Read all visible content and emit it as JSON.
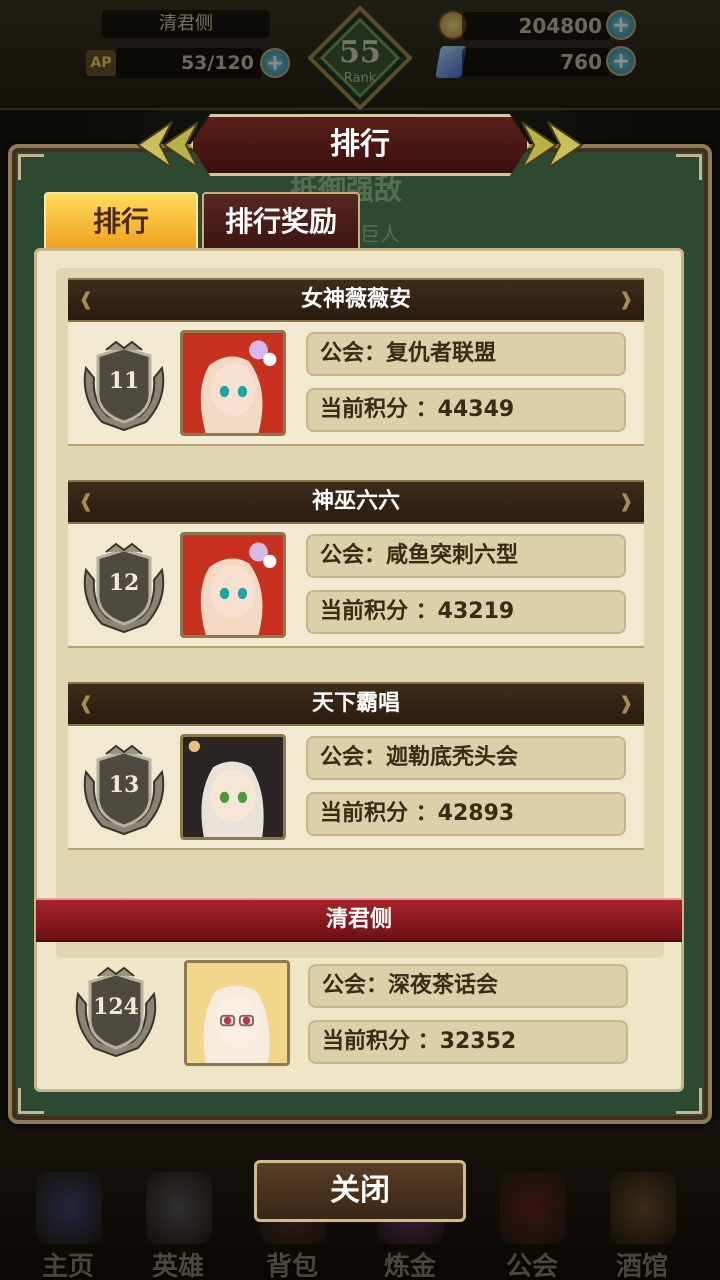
{
  "hud": {
    "player_name": "清君侧",
    "ap_icon": "AP",
    "ap": "53/120",
    "rank_value": "55",
    "rank_label": "Rank",
    "gold": "204800",
    "gems": "760"
  },
  "dialog": {
    "title": "排行",
    "behind_heading": "抵御强敌",
    "behind_sub": "巨人",
    "tabs": [
      {
        "label": "排行",
        "active": true
      },
      {
        "label": "排行奖励",
        "active": false
      }
    ],
    "entries": [
      {
        "name": "女神薇薇安",
        "rank": "11",
        "guild": "公会：复仇者联盟",
        "score": "当前积分 ：44349",
        "portrait": "red-hair-girl"
      },
      {
        "name": "神巫六六",
        "rank": "12",
        "guild": "公会：咸鱼突刺六型",
        "score": "当前积分 ：43219",
        "portrait": "red-hair-girl"
      },
      {
        "name": "天下霸唱",
        "rank": "13",
        "guild": "公会：迦勒底秃头会",
        "score": "当前积分 ：42893",
        "portrait": "dark-hair-girl"
      }
    ],
    "self": {
      "name": "清君侧",
      "rank": "124",
      "guild": "公会：深夜茶话会",
      "score": "当前积分 ：32352",
      "portrait": "blonde-glasses-girl"
    },
    "close_label": "关闭"
  },
  "nav": [
    {
      "label": "主页",
      "icon": "castle-icon",
      "color": "#5a6cc0"
    },
    {
      "label": "英雄",
      "icon": "helmet-icon",
      "color": "#8a8a96"
    },
    {
      "label": "背包",
      "icon": "bag-icon",
      "color": "#9a4a3a"
    },
    {
      "label": "炼金",
      "icon": "flask-icon",
      "color": "#a65ab0"
    },
    {
      "label": "公会",
      "icon": "shield-icon",
      "color": "#a03030"
    },
    {
      "label": "酒馆",
      "icon": "mug-icon",
      "color": "#b08040"
    }
  ]
}
